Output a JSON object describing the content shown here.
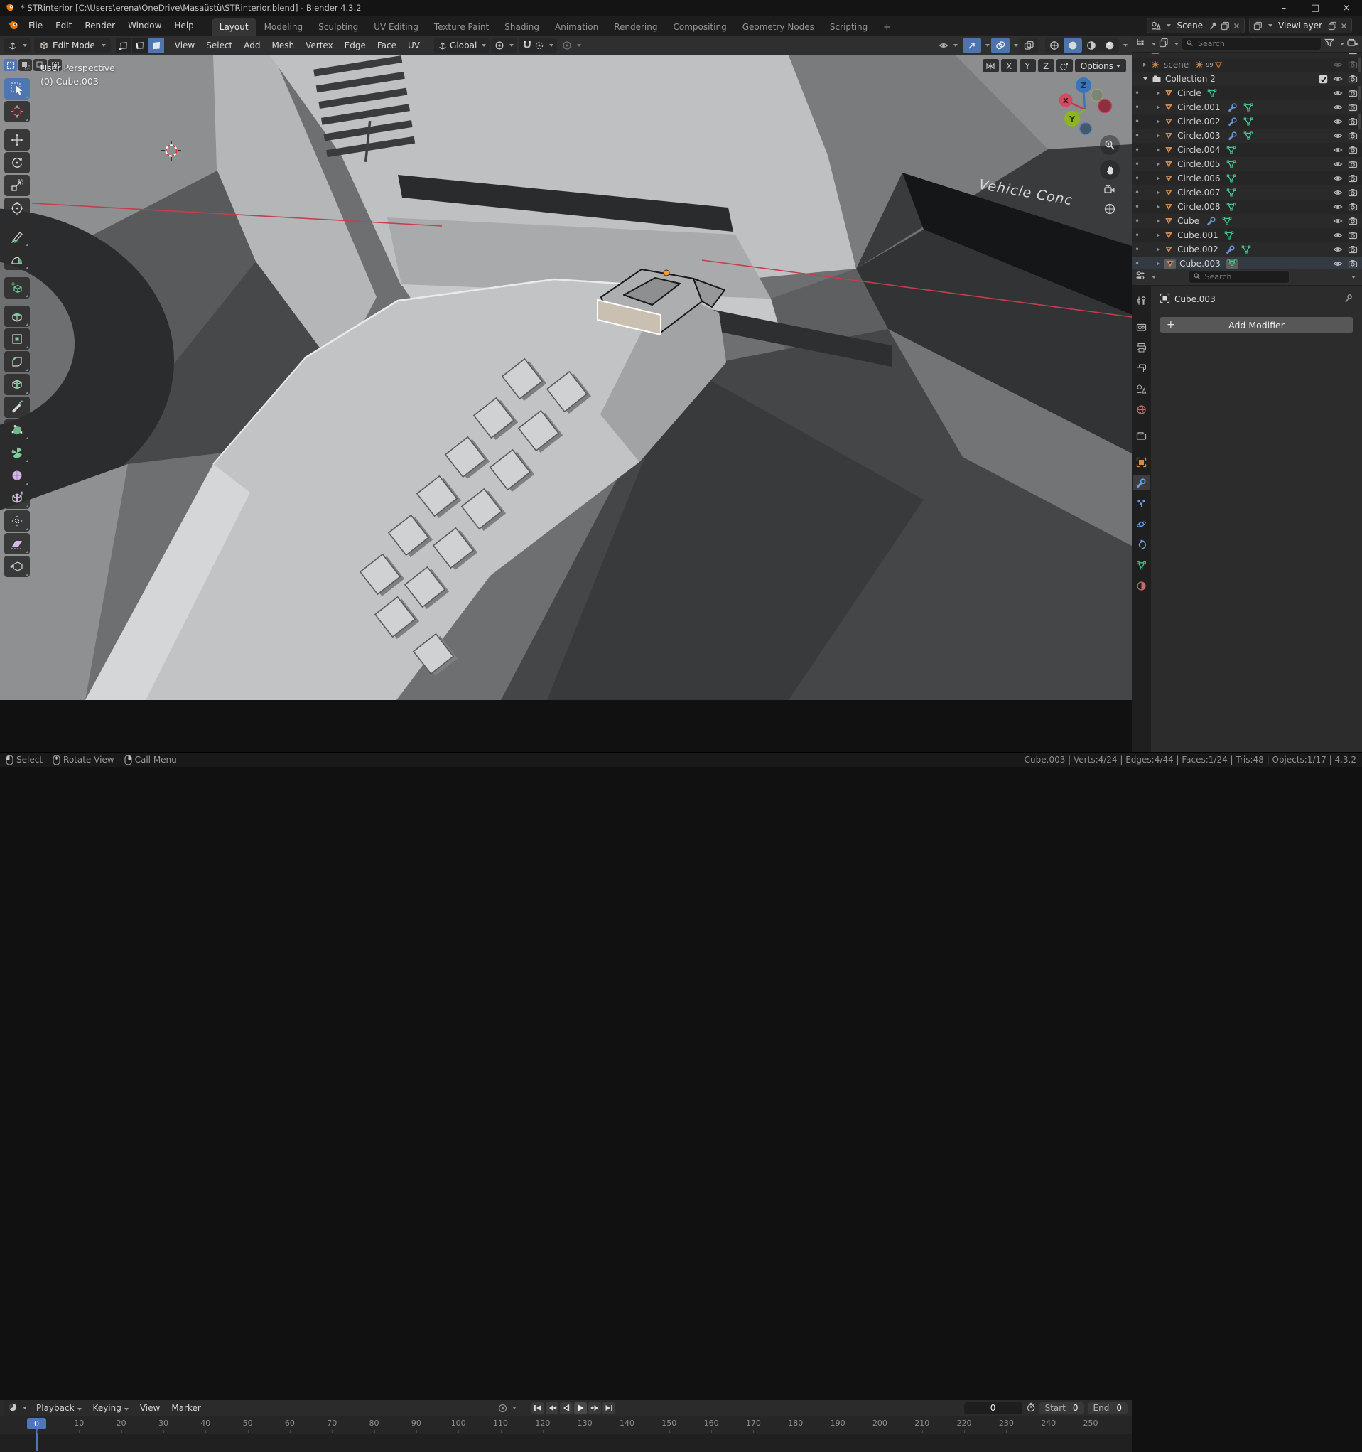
{
  "colors": {
    "accent_blue": "#4f76b0",
    "selection_orange": "#ff9b2e",
    "axis_x": "#d04b5e",
    "axis_y": "#8db421",
    "axis_z": "#3d74b8",
    "red_axis_line": "#c33f4e"
  },
  "titlebar": {
    "title": "* STRinterior [C:\\Users\\erena\\OneDrive\\Masaüstü\\STRinterior.blend] - Blender 4.3.2",
    "minimize": "–",
    "maximize": "□",
    "close": "×"
  },
  "topbar": {
    "menus": [
      "File",
      "Edit",
      "Render",
      "Window",
      "Help"
    ],
    "workspaces": [
      "Layout",
      "Modeling",
      "Sculpting",
      "UV Editing",
      "Texture Paint",
      "Shading",
      "Animation",
      "Rendering",
      "Compositing",
      "Geometry Nodes",
      "Scripting"
    ],
    "active_workspace": "Layout",
    "add_workspace": "+",
    "scene_selector": {
      "value": "Scene"
    },
    "viewlayer_selector": {
      "value": "ViewLayer"
    }
  },
  "viewport_header": {
    "mode_label": "Edit Mode",
    "menus": [
      "View",
      "Select",
      "Add",
      "Mesh",
      "Vertex",
      "Edge",
      "Face",
      "UV"
    ],
    "orientation_label": "Global"
  },
  "tool_settings": {
    "mirror_axes": [
      "X",
      "Y",
      "Z"
    ],
    "options_label": "Options"
  },
  "viewport": {
    "view_label": "User Perspective",
    "object_label": "(0) Cube.003",
    "decal_text": "Vehicle Conc",
    "gizmo": {
      "x_label": "X",
      "y_label": "Y",
      "z_label": "Z"
    }
  },
  "toolbar": {
    "active_tool": "tweak",
    "tools": [
      "tweak",
      "cursor",
      "move",
      "rotate",
      "scale",
      "transform",
      "annotate",
      "measure",
      "add-cube",
      "extrude-region",
      "inset-faces",
      "bevel",
      "loop-cut",
      "knife",
      "poly-build",
      "spin",
      "smooth",
      "edge-slide",
      "shrink-fatten",
      "shear",
      "rip-region"
    ]
  },
  "outliner": {
    "search_placeholder": "Search",
    "rows": [
      {
        "name": "Scene Collection",
        "type": "collection",
        "clipped": true
      },
      {
        "name": "scene",
        "type": "empty",
        "dim": true,
        "badge": "99"
      },
      {
        "name": "Collection 2",
        "type": "collection",
        "checkbox": true,
        "expanded": true
      },
      {
        "name": "Circle",
        "type": "mesh",
        "mods": false
      },
      {
        "name": "Circle.001",
        "type": "mesh",
        "mods": true
      },
      {
        "name": "Circle.002",
        "type": "mesh",
        "mods": true
      },
      {
        "name": "Circle.003",
        "type": "mesh",
        "mods": true
      },
      {
        "name": "Circle.004",
        "type": "mesh",
        "mods": false
      },
      {
        "name": "Circle.005",
        "type": "mesh",
        "mods": false
      },
      {
        "name": "Circle.006",
        "type": "mesh",
        "mods": false
      },
      {
        "name": "Circle.007",
        "type": "mesh",
        "mods": false
      },
      {
        "name": "Circle.008",
        "type": "mesh",
        "mods": false
      },
      {
        "name": "Cube",
        "type": "mesh",
        "mods": true
      },
      {
        "name": "Cube.001",
        "type": "mesh",
        "mods": false
      },
      {
        "name": "Cube.002",
        "type": "mesh",
        "mods": true
      },
      {
        "name": "Cube.003",
        "type": "mesh",
        "mods": false,
        "active": true
      }
    ]
  },
  "properties": {
    "search_placeholder": "Search",
    "breadcrumb": "Cube.003",
    "add_modifier_label": "Add Modifier",
    "plus": "+",
    "tabs": [
      "tool",
      "render",
      "output",
      "view-layer",
      "scene",
      "world",
      "collection",
      "object",
      "modifiers",
      "particles",
      "physics",
      "constraints",
      "object-data",
      "material"
    ],
    "active_tab": "modifiers"
  },
  "timeline": {
    "menus_dropdown": [
      "Playback",
      "Keying"
    ],
    "menus_plain": [
      "View",
      "Marker"
    ],
    "current_frame": "0",
    "start_label": "Start",
    "start_value": "0",
    "end_label": "End",
    "end_value": "0",
    "ticks": [
      0,
      10,
      20,
      30,
      40,
      50,
      60,
      70,
      80,
      90,
      100,
      110,
      120,
      130,
      140,
      150,
      160,
      170,
      180,
      190,
      200,
      210,
      220,
      230,
      240,
      250
    ]
  },
  "statusbar": {
    "hints": [
      {
        "label": "Select",
        "button": "left"
      },
      {
        "label": "Rotate View",
        "button": "middle"
      },
      {
        "label": "Call Menu",
        "button": "right"
      }
    ],
    "stats": [
      "Cube.003",
      "Verts:4/24",
      "Edges:4/44",
      "Faces:1/24",
      "Tris:48",
      "Objects:1/17",
      "4.3.2"
    ]
  }
}
